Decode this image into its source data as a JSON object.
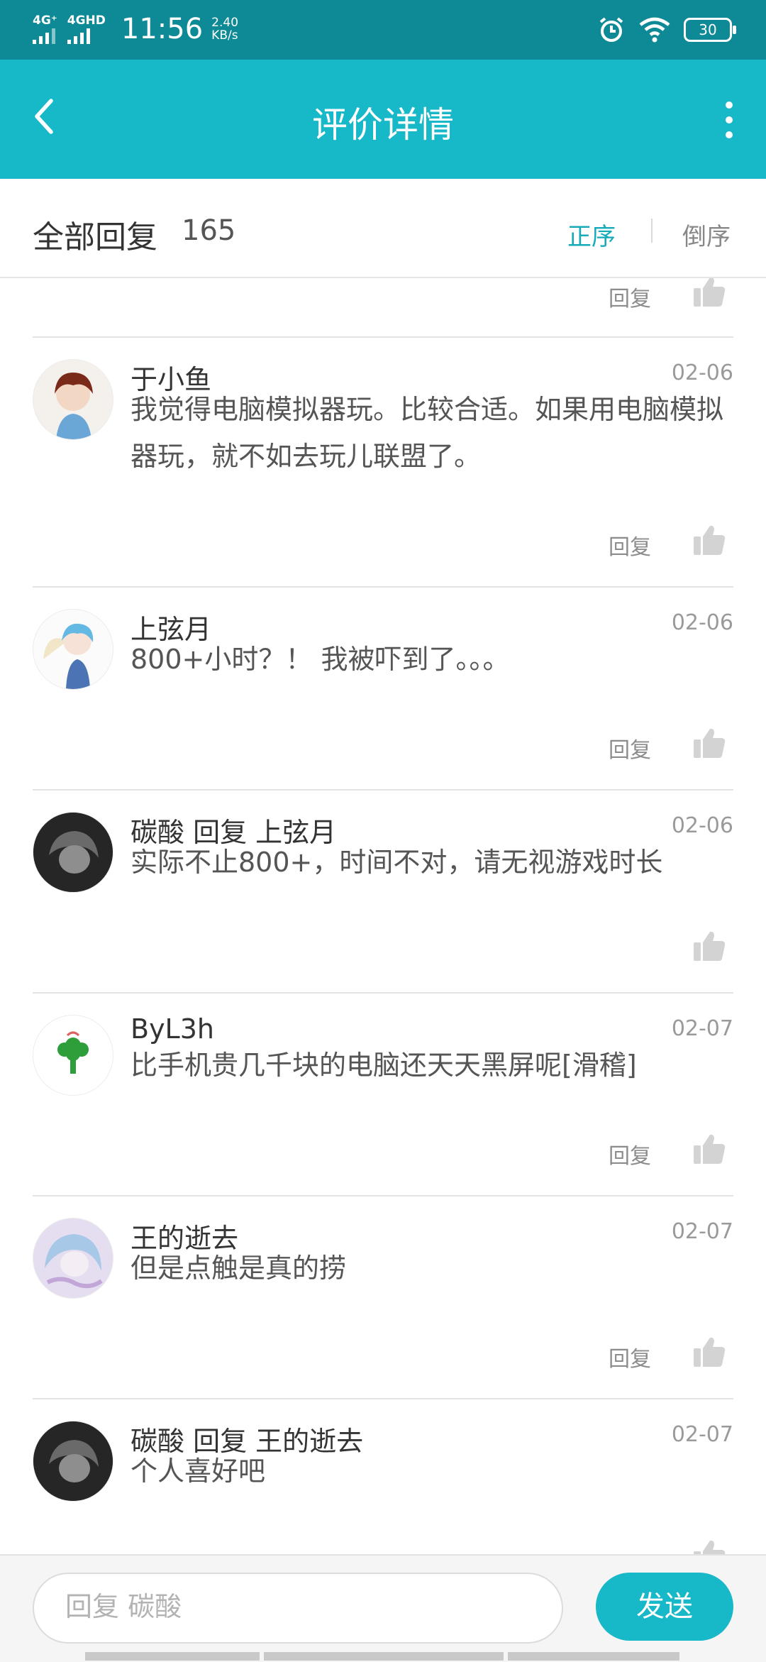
{
  "status_bar": {
    "net1": "4G⁺",
    "net2": "4GHD",
    "time": "11:56",
    "speed_value": "2.40",
    "speed_unit": "KB/s",
    "battery": "30"
  },
  "app_bar": {
    "title": "评价详情",
    "back_icon": "chevron-left-icon",
    "more_icon": "more-vertical-icon"
  },
  "header": {
    "all_replies_label": "全部回复",
    "count": "165",
    "sort_asc": "正序",
    "sort_desc": "倒序"
  },
  "partial_row": {
    "reply_label": "回复"
  },
  "comments": [
    {
      "name": "于小鱼",
      "date": "02-06",
      "text": "我觉得电脑模拟器玩。比较合适。如果用电脑模拟器玩，就不如去玩儿联盟了。",
      "reply_label": "回复"
    },
    {
      "name": "上弦月",
      "date": "02-06",
      "text": "800+小时？！ 我被吓到了。。。",
      "reply_label": "回复"
    },
    {
      "name": "碳酸  回复  上弦月",
      "date": "02-06",
      "text": "实际不止800+，时间不对，请无视游戏时长"
    },
    {
      "name": "ByL3h",
      "date": "02-07",
      "text": "比手机贵几千块的电脑还天天黑屏呢[滑稽]",
      "reply_label": "回复"
    },
    {
      "name": "王的逝去",
      "date": "02-07",
      "text": "但是点触是真的捞",
      "reply_label": "回复"
    },
    {
      "name": "碳酸  回复  王的逝去",
      "date": "02-07",
      "text": "个人喜好吧"
    }
  ],
  "bottom_bar": {
    "input_placeholder": "回复 碳酸",
    "send_label": "发送"
  },
  "colors": {
    "status_bar": "#0e8a96",
    "app_bar": "#17b8c8",
    "accent": "#17aab8"
  }
}
